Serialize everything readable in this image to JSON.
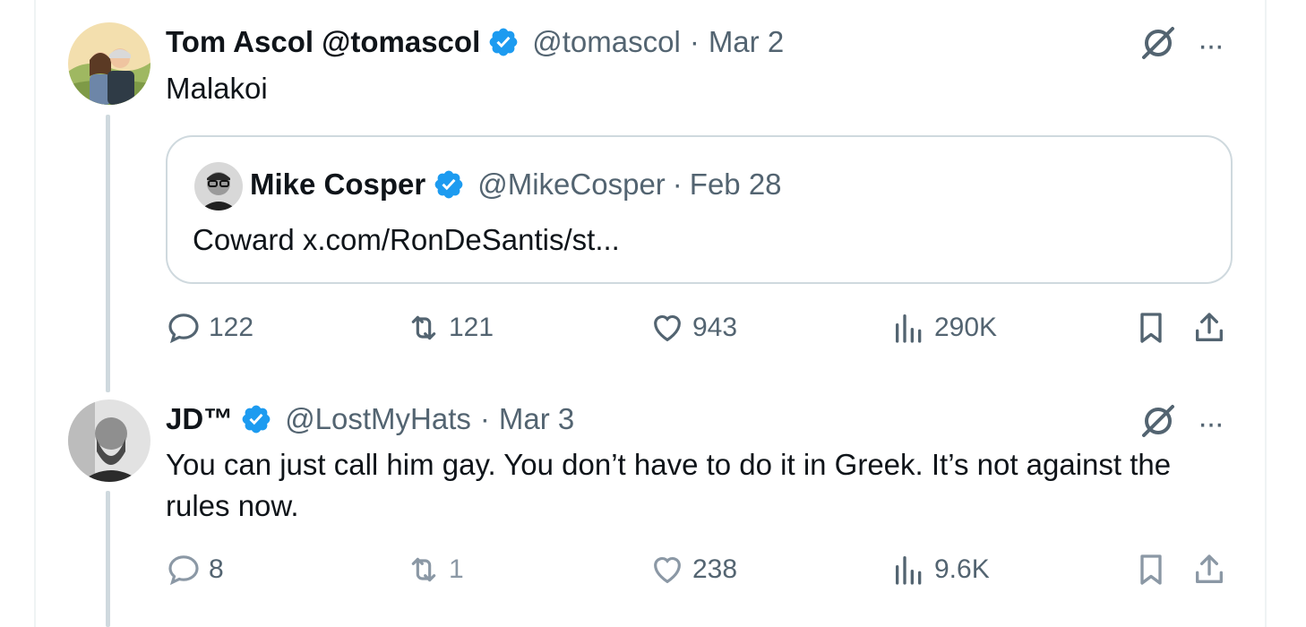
{
  "tweets": [
    {
      "name": "Tom Ascol @tomascol",
      "handle": "@tomascol",
      "separator": "·",
      "date": "Mar 2",
      "text": "Malakoi",
      "quote": {
        "name": "Mike Cosper",
        "handle": "@MikeCosper",
        "separator": "·",
        "date": "Feb 28",
        "text": "Coward x.com/RonDeSantis/st..."
      },
      "actions": {
        "replies": "122",
        "reposts": "121",
        "likes": "943",
        "views": "290K"
      }
    },
    {
      "name": "JD™",
      "handle": "@LostMyHats",
      "separator": "·",
      "date": "Mar 3",
      "text": "You can just call him gay. You don’t have to do it in Greek. It’s not against the rules now.",
      "actions": {
        "replies": "8",
        "reposts": "1",
        "likes": "238",
        "views": "9.6K"
      }
    }
  ],
  "ui": {
    "more_label": "···"
  },
  "icons": [
    "verified-badge-icon",
    "grok-icon",
    "more-icon",
    "reply-icon",
    "repost-icon",
    "like-icon",
    "views-icon",
    "bookmark-icon",
    "share-icon"
  ],
  "colors": {
    "verified": "#1d9bf0",
    "text": "#0f1419",
    "muted": "#536471",
    "thread": "#cfd9de",
    "border": "#cfd9de"
  }
}
